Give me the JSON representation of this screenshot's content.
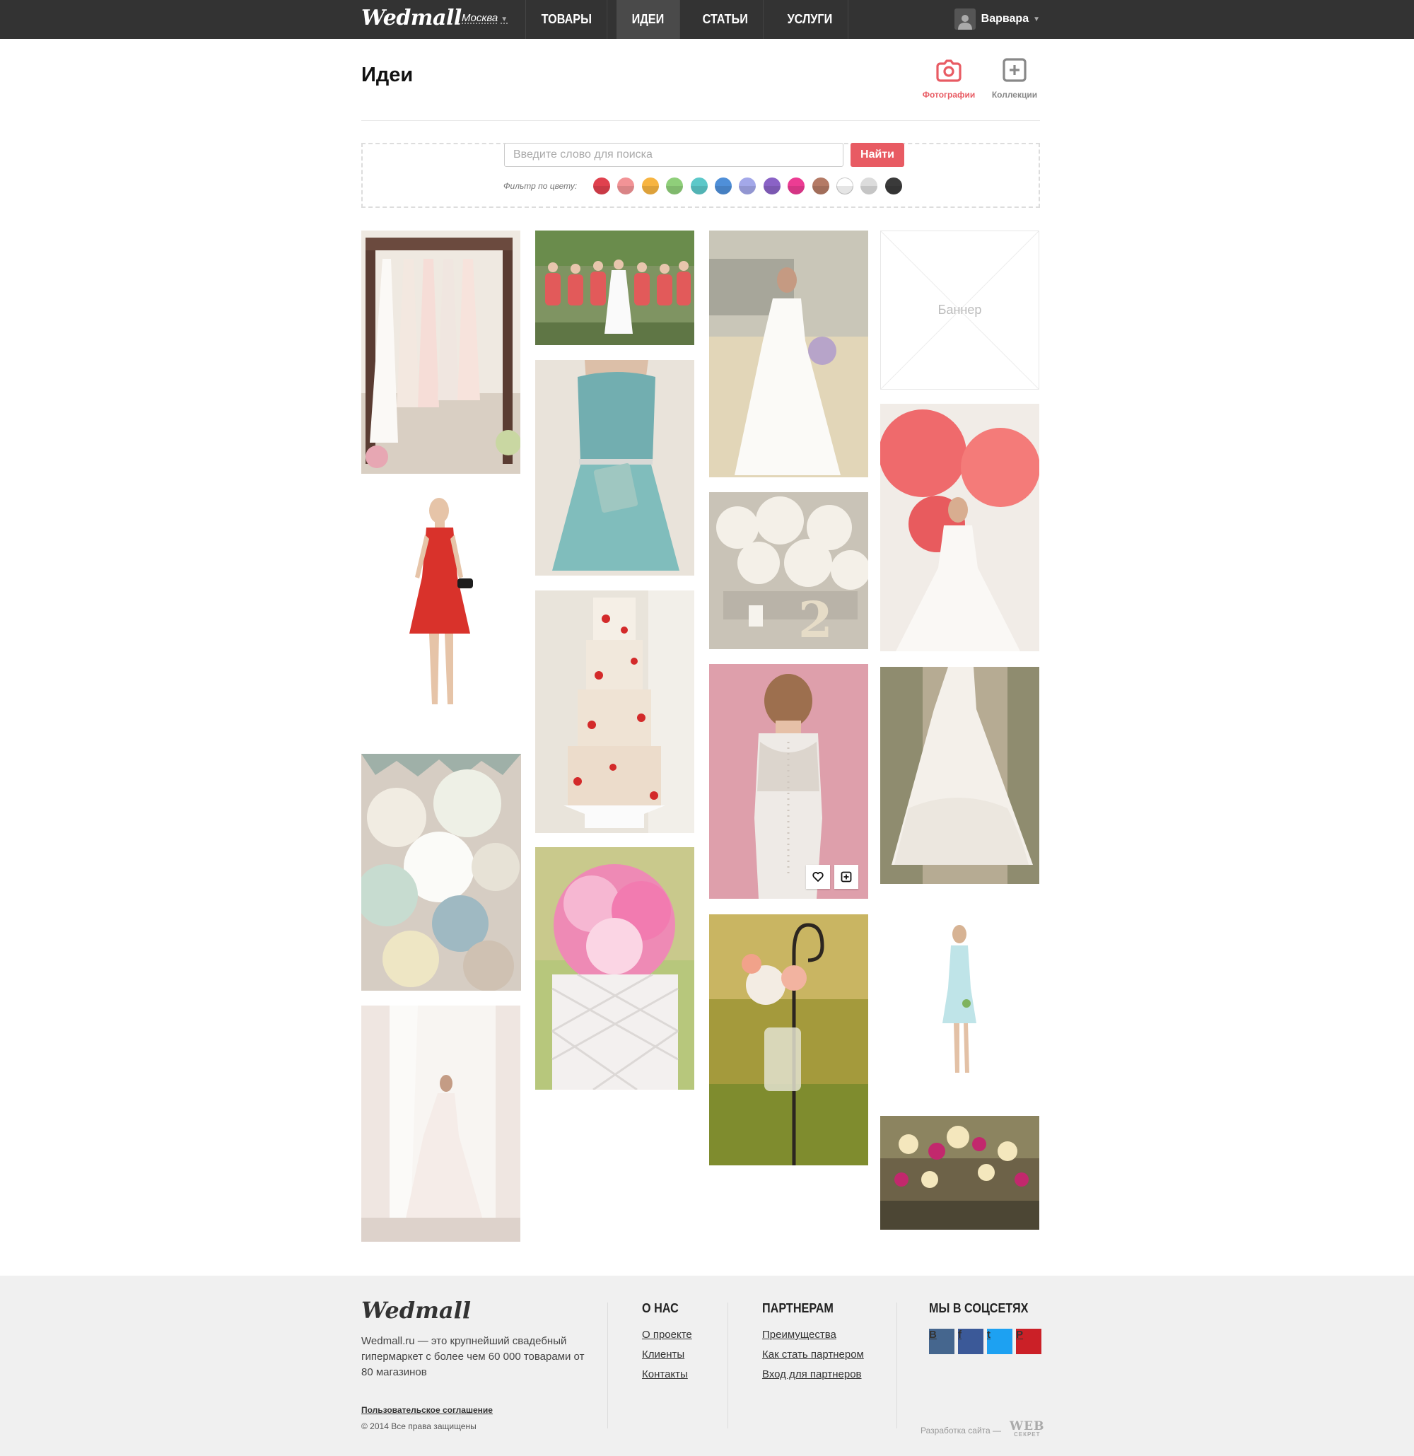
{
  "header": {
    "logo": "Wedmall",
    "city": "Москва",
    "nav": [
      {
        "label": "ТОВАРЫ",
        "active": false
      },
      {
        "label": "ИДЕИ",
        "active": true
      },
      {
        "label": "СТАТЬИ",
        "active": false
      },
      {
        "label": "УСЛУГИ",
        "active": false
      }
    ],
    "user_name": "Варвара"
  },
  "page": {
    "title": "Идеи",
    "views": {
      "photos": "Фотографии",
      "collections": "Коллекции"
    },
    "active_view": "photos"
  },
  "search": {
    "placeholder": "Введите слово для поиска",
    "button": "Найти",
    "filter_label": "Фильтр по цвету:",
    "colors": [
      "#e0414e",
      "#f29396",
      "#f7b441",
      "#8fcf7a",
      "#5cc8c9",
      "#4f8fd8",
      "#a3a8e9",
      "#8a62c6",
      "#ec3c93",
      "#b47a65",
      "#ffffff",
      "#dcdcdc",
      "#3a3a3a"
    ]
  },
  "grid": {
    "tiles": [
      {
        "name": "dresses-on-rack",
        "col": 0,
        "tone": "cream"
      },
      {
        "name": "model-red-dress",
        "col": 0,
        "tone": "white"
      },
      {
        "name": "paper-lanterns",
        "col": 0,
        "tone": "pastel"
      },
      {
        "name": "bride-at-window",
        "col": 0,
        "tone": "light"
      },
      {
        "name": "bridesmaids-group",
        "col": 1,
        "tone": "green"
      },
      {
        "name": "turquoise-dress",
        "col": 1,
        "tone": "teal"
      },
      {
        "name": "naked-cake-strawberries",
        "col": 1,
        "tone": "cream"
      },
      {
        "name": "peony-cake",
        "col": 1,
        "tone": "pink"
      },
      {
        "name": "bride-in-field",
        "col": 2,
        "tone": "warm"
      },
      {
        "name": "white-flowers-table-number",
        "col": 2,
        "tone": "pale"
      },
      {
        "name": "lace-back-dress",
        "col": 2,
        "tone": "rose",
        "hovered": true
      },
      {
        "name": "jar-flowers-hook",
        "col": 2,
        "tone": "golden"
      },
      {
        "name": "bride-red-balloons",
        "col": 3,
        "tone": "light"
      },
      {
        "name": "ruffled-gown-path",
        "col": 3,
        "tone": "earth"
      },
      {
        "name": "mint-bridesmaid-dress",
        "col": 3,
        "tone": "white"
      },
      {
        "name": "garden-lanterns-party",
        "col": 3,
        "tone": "dusk"
      }
    ],
    "banner_label": "Баннер"
  },
  "footer": {
    "logo": "Wedmall",
    "about": "Wedmall.ru — это крупнейший свадебный гипермаркет с более чем 60 000 товарами от 80 магазинов",
    "agreement": "Пользовательское соглашение",
    "copyright": "© 2014 Все права защищены",
    "about_us": {
      "title": "О НАС",
      "links": [
        "О проекте",
        "Клиенты",
        "Контакты"
      ]
    },
    "partners": {
      "title": "ПАРТНЕРАМ",
      "links": [
        "Преимущества",
        "Как стать партнером",
        "Вход для партнеров"
      ]
    },
    "social": {
      "title": "МЫ В СОЦСЕТЯХ",
      "networks": [
        "vk",
        "facebook",
        "twitter",
        "pinterest"
      ],
      "glyphs": [
        "В",
        "f",
        "t",
        "P"
      ],
      "colors": [
        "#45668e",
        "#3b5998",
        "#1da1f2",
        "#cb2027"
      ]
    },
    "developer": "Разработка сайта —",
    "developer_logo": "WEB",
    "developer_logo_sub": "СЕКРЕТ"
  }
}
